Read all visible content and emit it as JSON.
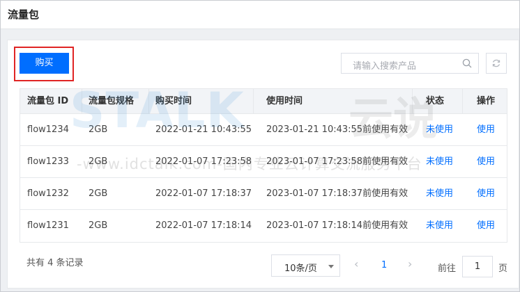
{
  "page": {
    "title": "流量包"
  },
  "toolbar": {
    "buy_label": "购买",
    "search_placeholder": "请输入搜索产品"
  },
  "table": {
    "columns": [
      "流量包 ID",
      "流量包规格",
      "购买时间",
      "使用时间",
      "状态",
      "操作"
    ],
    "rows": [
      {
        "id": "flow1234",
        "spec": "2GB",
        "purchase_time": "2022-01-21 10:43:55",
        "use_time": "2023-01-21 10:43:55前使用有效",
        "status": "未使用",
        "action": "使用"
      },
      {
        "id": "flow1233",
        "spec": "2GB",
        "purchase_time": "2022-01-07 17:23:58",
        "use_time": "2023-01-07 17:23:58前使用有效",
        "status": "未使用",
        "action": "使用"
      },
      {
        "id": "flow1232",
        "spec": "2GB",
        "purchase_time": "2022-01-07 17:18:37",
        "use_time": "2023-01-07 17:18:37前使用有效",
        "status": "未使用",
        "action": "使用"
      },
      {
        "id": "flow1231",
        "spec": "2GB",
        "purchase_time": "2022-01-07 17:18:14",
        "use_time": "2023-01-07 17:18:14前使用有效",
        "status": "未使用",
        "action": "使用"
      }
    ]
  },
  "pagination": {
    "total_text": "共有 4 条记录",
    "page_size": "10条/页",
    "current_page": "1",
    "goto_label": "前往",
    "goto_value": "1",
    "page_suffix": "页"
  },
  "watermark": {
    "brand": "STALK",
    "brand_cn": "云说",
    "url_text": "-www.idctalk.com-国内专业云计算交流服务平台"
  },
  "colors": {
    "accent": "#006eff",
    "highlight": "#e02424"
  }
}
